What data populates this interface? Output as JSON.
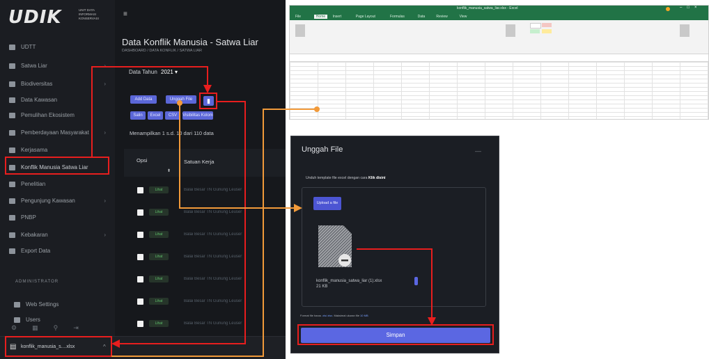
{
  "app": {
    "logo": "UDIK",
    "logo_sub": "UNIT DATA INFORMASI KONSERVASI",
    "title": "Data Konflik Manusia - Satwa Liar",
    "breadcrumb": "DASHBOARD / DATA KONFLIK / SATWA LIAR",
    "year_label": "Data Tahun",
    "year_value": "2021 ▾",
    "buttons": [
      "Add Data",
      "Unggah File",
      "Salin",
      "Excel",
      "CSV",
      "Visibilitas Kolom"
    ],
    "showing_text": "Menampilkan 1 s.d. 10 dari 110 data",
    "table_headers": [
      "Opsi",
      "Satuan Kerja"
    ],
    "view_label": "Lihat",
    "row_cell": "Balai Besar TN Gunung Leuser",
    "download_filename": "konflik_manusia_s....xlsx",
    "admin_header": "ADMINISTRATOR",
    "nav_items": [
      {
        "label": "UDTT",
        "chevron": false
      },
      {
        "label": "Satwa Liar",
        "chevron": true
      },
      {
        "label": "Biodiversitas",
        "chevron": true
      },
      {
        "label": "Data Kawasan",
        "chevron": false
      },
      {
        "label": "Pemulihan Ekosistem",
        "chevron": false
      },
      {
        "label": "Pemberdayaan Masyarakat",
        "chevron": true
      },
      {
        "label": "Kerjasama",
        "chevron": false
      },
      {
        "label": "Konflik Manusia Satwa Liar",
        "chevron": false
      },
      {
        "label": "Penelitian",
        "chevron": false
      },
      {
        "label": "Pengunjung Kawasan",
        "chevron": true
      },
      {
        "label": "PNBP",
        "chevron": false
      },
      {
        "label": "Kebakaran",
        "chevron": true
      },
      {
        "label": "Export Data",
        "chevron": false
      }
    ],
    "admin_items": [
      {
        "label": "Web Settings"
      },
      {
        "label": "Users"
      }
    ]
  },
  "excel": {
    "window_title": "konflik_manusia_satwa_liar.xlsx - Excel",
    "tabs": [
      "File",
      "Home",
      "Insert",
      "Page Layout",
      "Formulas",
      "Data",
      "Review",
      "View"
    ]
  },
  "modal": {
    "title": "Unggah File",
    "close": "—",
    "instruction_prefix": "Unduh template file excel dengan cara ",
    "instruction_bold": "Klik disini",
    "upload_button": "Upload a file",
    "file_name": "konflik_manusia_satwa_liar (1).xlsx",
    "file_size": "21 KB",
    "footer_note": "Format file harus ",
    "footer_format": ".xls/.xlsx",
    "footer_mid": ". Maksimal ukuran file ",
    "footer_size": "10 MB",
    "save_button": "Simpan"
  },
  "colors": {
    "annotation_red": "#e81e1e",
    "annotation_orange": "#f29a3a",
    "primary_button": "#5b67d8",
    "excel_green": "#217346"
  }
}
